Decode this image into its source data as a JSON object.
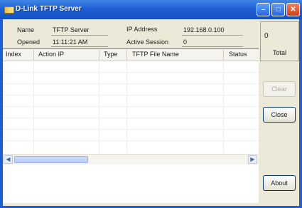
{
  "window": {
    "title": "D-Link TFTP Server"
  },
  "info": {
    "name_label": "Name",
    "name_value": "TFTP Server",
    "ip_label": "IP Address",
    "ip_value": "192.168.0.100",
    "opened_label": "Opened",
    "opened_value": "11:11:21 AM",
    "sessions_label": "Active Session",
    "sessions_value": "0"
  },
  "table": {
    "columns": [
      "Index",
      "Action IP",
      "Type",
      "TFTP File Name",
      "Status"
    ]
  },
  "side": {
    "count": "0",
    "total_label": "Total",
    "clear_label": "Clear",
    "close_label": "Close",
    "about_label": "About"
  },
  "colors": {
    "title_bar": "#1f5fd4",
    "window_face": "#ece9d8",
    "close_button": "#d0401c"
  },
  "icons": [
    "app-icon",
    "minimize-icon",
    "maximize-icon",
    "close-icon",
    "scroll-left-icon",
    "scroll-right-icon"
  ]
}
